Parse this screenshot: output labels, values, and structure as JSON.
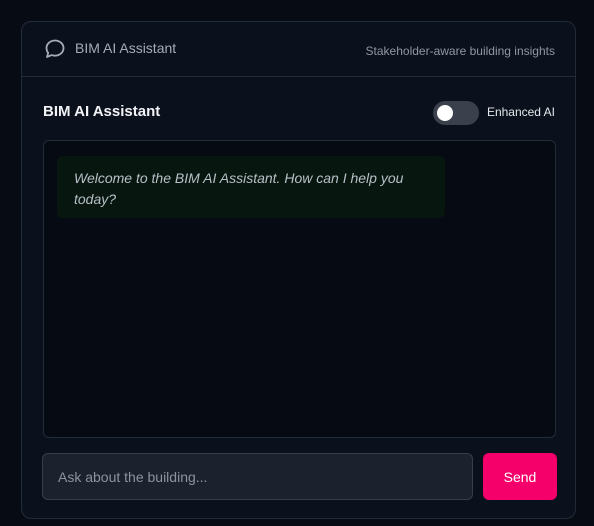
{
  "header": {
    "icon": "chat-bubble-icon",
    "title": "BIM AI Assistant",
    "subtitle": "Stakeholder-aware building insights"
  },
  "assistant": {
    "title": "BIM AI Assistant",
    "toggle": {
      "label": "Enhanced AI",
      "enabled": false
    }
  },
  "chat": {
    "messages": [
      {
        "role": "assistant",
        "text": "Welcome to the BIM AI Assistant. How can I help you today?"
      }
    ]
  },
  "composer": {
    "placeholder": "Ask about the building...",
    "value": "",
    "send_label": "Send"
  },
  "colors": {
    "accent": "#f5006b",
    "background": "#070b14",
    "panel": "#0b111c",
    "message_bg": "#07170f"
  }
}
